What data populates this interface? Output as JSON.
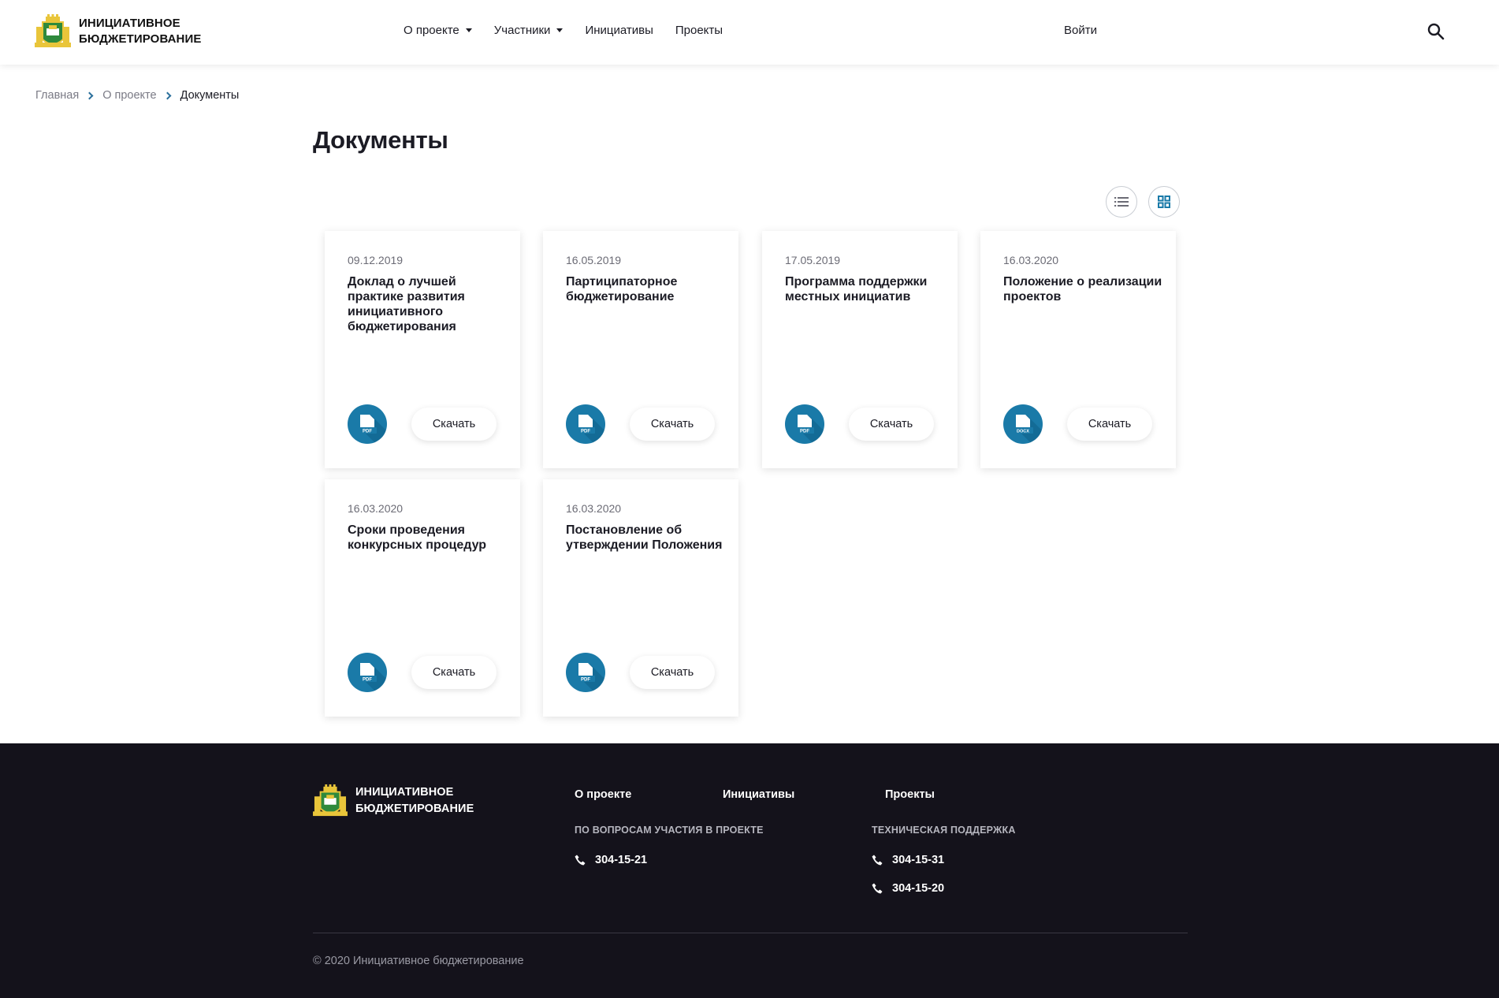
{
  "header": {
    "logo_line1": "ИНИЦИАТИВНОЕ",
    "logo_line2": "БЮДЖЕТИРОВАНИЕ",
    "nav": [
      {
        "label": "О проекте"
      },
      {
        "label": "Участники"
      },
      {
        "label": "Инициативы"
      },
      {
        "label": "Проекты"
      }
    ],
    "login_label": "Войти"
  },
  "breadcrumb": [
    "Главная",
    "О проекте",
    "Документы"
  ],
  "page_title": "Документы",
  "documents": [
    {
      "date": "09.12.2019",
      "title": "Доклад о лучшей практике развития инициативного бюджетирования",
      "file_type": "PDF",
      "download_label": "Скачать"
    },
    {
      "date": "16.05.2019",
      "title": "Партиципаторное бюджетирование",
      "file_type": "PDF",
      "download_label": "Скачать"
    },
    {
      "date": "17.05.2019",
      "title": "Программа поддержки местных инициатив",
      "file_type": "PDF",
      "download_label": "Скачать"
    },
    {
      "date": "16.03.2020",
      "title": "Положение о реализации проектов",
      "file_type": "DOCX",
      "download_label": "Скачать"
    },
    {
      "date": "16.03.2020",
      "title": "Сроки проведения конкурсных процедур",
      "file_type": "PDF",
      "download_label": "Скачать"
    },
    {
      "date": "16.03.2020",
      "title": "Постановление об утверждении Положения",
      "file_type": "PDF",
      "download_label": "Скачать"
    }
  ],
  "footer": {
    "logo_line1": "ИНИЦИАТИВНОЕ",
    "logo_line2": "БЮДЖЕТИРОВАНИЕ",
    "nav": [
      "О проекте",
      "Инициативы",
      "Проекты"
    ],
    "participation_title": "ПО ВОПРОСАМ УЧАСТИЯ В ПРОЕКТЕ",
    "participation_phones": [
      "304-15-21"
    ],
    "support_title": "ТЕХНИЧЕСКАЯ ПОДДЕРЖКА",
    "support_phones": [
      "304-15-31",
      "304-15-20"
    ],
    "copyright": "© 2020 Инициативное бюджетирование"
  },
  "colors": {
    "accent": "#1a7aa8",
    "footer_bg": "#14121b",
    "crest_yellow": "#e9c53a",
    "crest_green": "#2f8a3c"
  }
}
